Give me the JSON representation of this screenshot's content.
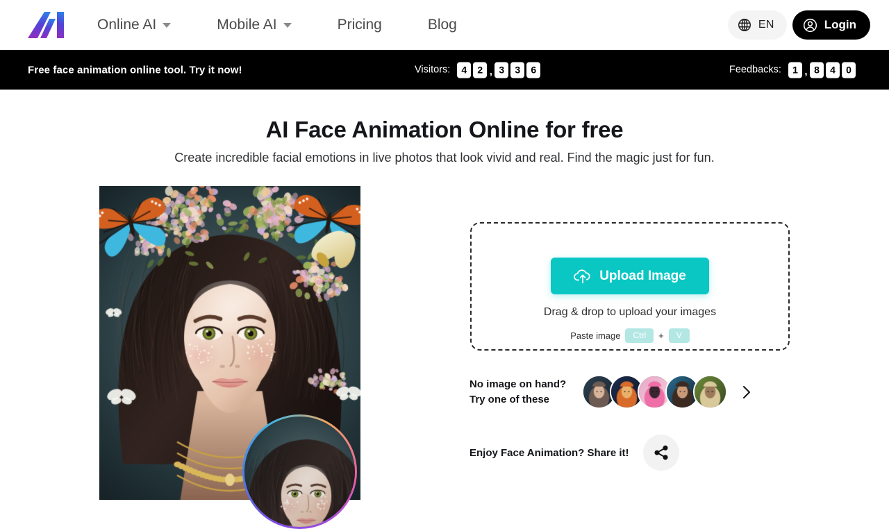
{
  "header": {
    "logo_alt": "AI",
    "nav": [
      {
        "label": "Online AI",
        "has_dropdown": true
      },
      {
        "label": "Mobile AI",
        "has_dropdown": true
      },
      {
        "label": "Pricing",
        "has_dropdown": false
      },
      {
        "label": "Blog",
        "has_dropdown": false
      }
    ],
    "language": {
      "icon": "globe-icon",
      "label": "EN"
    },
    "login": {
      "icon": "user-circle-icon",
      "label": "Login"
    }
  },
  "banner": {
    "promo": "Free face animation online tool. Try it now!",
    "visitors_label": "Visitors:",
    "visitors_digits": [
      "4",
      "2",
      ",",
      "3",
      "3",
      "6"
    ],
    "feedbacks_label": "Feedbacks:",
    "feedbacks_digits": [
      "1",
      ",",
      "8",
      "4",
      "0"
    ]
  },
  "hero": {
    "title": "AI Face Animation Online for free",
    "subtitle": "Create incredible facial emotions in live photos that look vivid and real. Find the magic just for fun.",
    "preview_alt": "Portrait of a woman with butterflies and flowers in her hair",
    "inset_alt": "Animated face preview close-up"
  },
  "upload": {
    "button_label": "Upload Image",
    "button_icon": "cloud-upload-icon",
    "drag_text": "Drag & drop to upload your images",
    "paste_label": "Paste image",
    "key_ctrl": "Ctrl",
    "key_plus": "+",
    "key_v": "V"
  },
  "samples": {
    "line1": "No image on hand?",
    "line2": "Try one of these",
    "items": [
      {
        "alt": "Sample portrait 1"
      },
      {
        "alt": "Sample portrait 2"
      },
      {
        "alt": "Sample portrait 3"
      },
      {
        "alt": "Sample portrait 4"
      },
      {
        "alt": "Sample portrait 5"
      }
    ],
    "next_icon": "chevron-right-icon"
  },
  "share": {
    "label": "Enjoy Face Animation? Share it!",
    "icon": "share-icon"
  },
  "colors": {
    "accent_teal": "#0ac7c4",
    "key_chip": "#b3e7e4",
    "banner_bg": "#000000",
    "text_dark": "#14161a",
    "nav_text": "#4b4b4b"
  }
}
